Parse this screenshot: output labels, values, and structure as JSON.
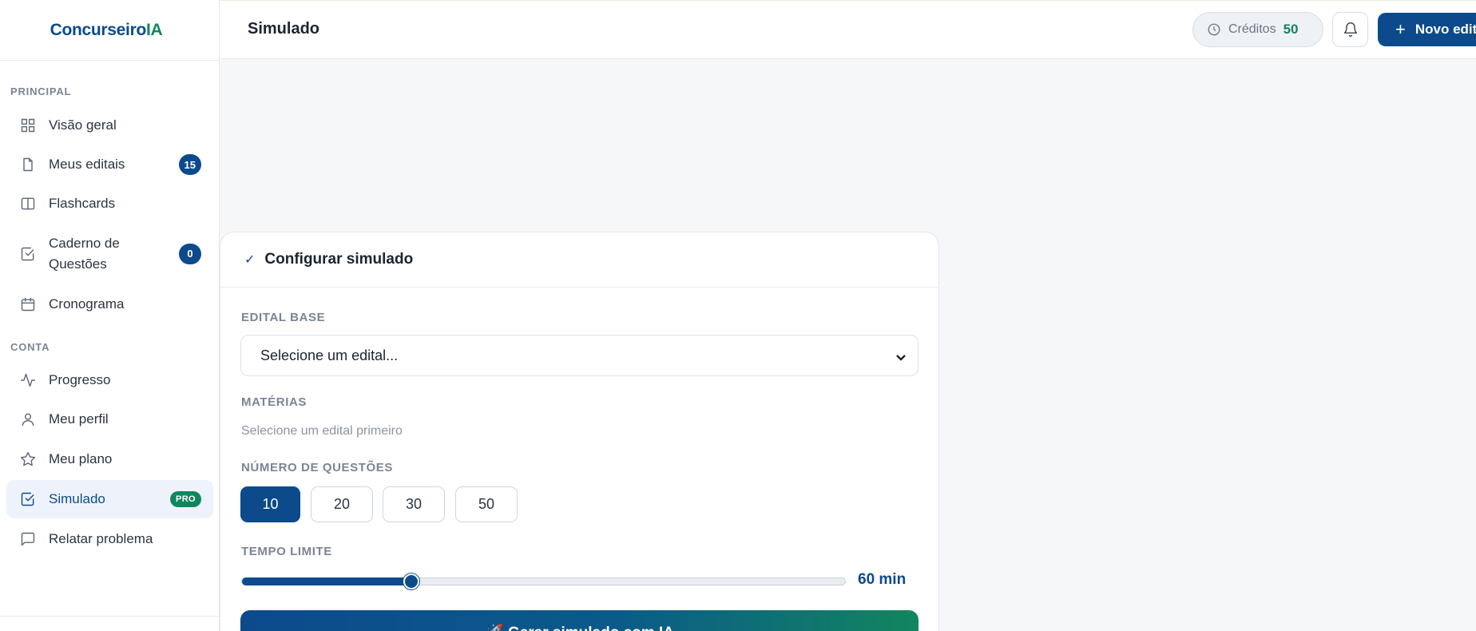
{
  "brand": {
    "part1": "Concurseiro",
    "part2": "IA"
  },
  "sidebar": {
    "sections": [
      {
        "label": "PRINCIPAL"
      },
      {
        "label": "CONTA"
      }
    ],
    "items": [
      {
        "label": "Visão geral",
        "icon": "grid-icon"
      },
      {
        "label": "Meus editais",
        "icon": "file-icon",
        "badge": "15"
      },
      {
        "label": "Flashcards",
        "icon": "book-icon"
      },
      {
        "label": "Caderno de Questões",
        "icon": "checkbox-icon",
        "badge": "0"
      },
      {
        "label": "Cronograma",
        "icon": "calendar-icon"
      },
      {
        "label": "Progresso",
        "icon": "activity-icon"
      },
      {
        "label": "Meu perfil",
        "icon": "user-icon"
      },
      {
        "label": "Meu plano",
        "icon": "star-icon"
      },
      {
        "label": "Simulado",
        "icon": "checkbox-icon",
        "badge": "PRO",
        "active": true
      },
      {
        "label": "Relatar problema",
        "icon": "message-icon"
      }
    ]
  },
  "header": {
    "title": "Simulado",
    "credits_label": "Créditos",
    "credits_value": "50",
    "new_button_label": "Novo edital"
  },
  "card": {
    "title": "Configurar simulado",
    "edital_label": "EDITAL BASE",
    "edital_selected": "Selecione um edital...",
    "materias_label": "MATÉRIAS",
    "materias_hint": "Selecione um edital primeiro",
    "questoes_label": "NÚMERO DE QUESTÕES",
    "questoes_options": [
      "10",
      "20",
      "30",
      "50"
    ],
    "questoes_selected": "10",
    "tempo_label": "TEMPO LIMITE",
    "tempo_value_text": "60 min",
    "tempo_fraction": 0.28,
    "generate_label": "🚀 Gerar simulado com IA"
  },
  "colors": {
    "primary": "#0c4a8c",
    "accent": "#12855e"
  }
}
